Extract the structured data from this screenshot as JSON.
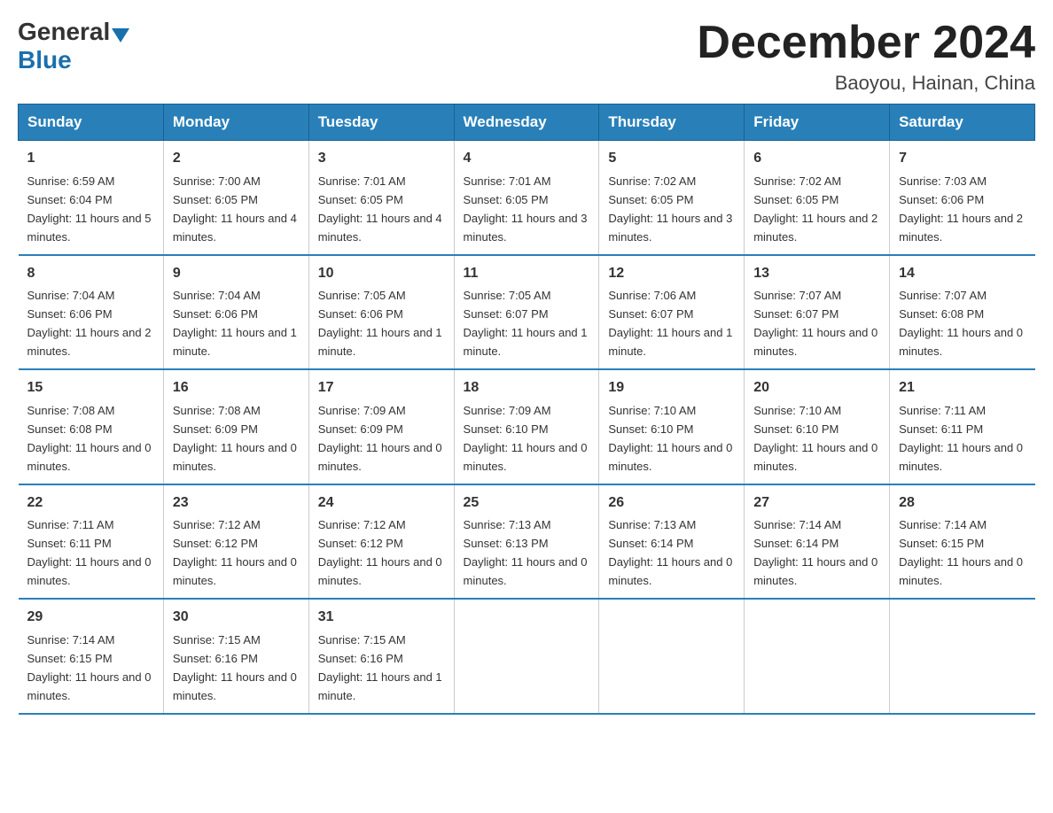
{
  "logo": {
    "general": "General",
    "blue": "Blue"
  },
  "header": {
    "month": "December 2024",
    "location": "Baoyou, Hainan, China"
  },
  "weekdays": [
    "Sunday",
    "Monday",
    "Tuesday",
    "Wednesday",
    "Thursday",
    "Friday",
    "Saturday"
  ],
  "weeks": [
    [
      {
        "day": "1",
        "sunrise": "6:59 AM",
        "sunset": "6:04 PM",
        "daylight": "11 hours and 5 minutes."
      },
      {
        "day": "2",
        "sunrise": "7:00 AM",
        "sunset": "6:05 PM",
        "daylight": "11 hours and 4 minutes."
      },
      {
        "day": "3",
        "sunrise": "7:01 AM",
        "sunset": "6:05 PM",
        "daylight": "11 hours and 4 minutes."
      },
      {
        "day": "4",
        "sunrise": "7:01 AM",
        "sunset": "6:05 PM",
        "daylight": "11 hours and 3 minutes."
      },
      {
        "day": "5",
        "sunrise": "7:02 AM",
        "sunset": "6:05 PM",
        "daylight": "11 hours and 3 minutes."
      },
      {
        "day": "6",
        "sunrise": "7:02 AM",
        "sunset": "6:05 PM",
        "daylight": "11 hours and 2 minutes."
      },
      {
        "day": "7",
        "sunrise": "7:03 AM",
        "sunset": "6:06 PM",
        "daylight": "11 hours and 2 minutes."
      }
    ],
    [
      {
        "day": "8",
        "sunrise": "7:04 AM",
        "sunset": "6:06 PM",
        "daylight": "11 hours and 2 minutes."
      },
      {
        "day": "9",
        "sunrise": "7:04 AM",
        "sunset": "6:06 PM",
        "daylight": "11 hours and 1 minute."
      },
      {
        "day": "10",
        "sunrise": "7:05 AM",
        "sunset": "6:06 PM",
        "daylight": "11 hours and 1 minute."
      },
      {
        "day": "11",
        "sunrise": "7:05 AM",
        "sunset": "6:07 PM",
        "daylight": "11 hours and 1 minute."
      },
      {
        "day": "12",
        "sunrise": "7:06 AM",
        "sunset": "6:07 PM",
        "daylight": "11 hours and 1 minute."
      },
      {
        "day": "13",
        "sunrise": "7:07 AM",
        "sunset": "6:07 PM",
        "daylight": "11 hours and 0 minutes."
      },
      {
        "day": "14",
        "sunrise": "7:07 AM",
        "sunset": "6:08 PM",
        "daylight": "11 hours and 0 minutes."
      }
    ],
    [
      {
        "day": "15",
        "sunrise": "7:08 AM",
        "sunset": "6:08 PM",
        "daylight": "11 hours and 0 minutes."
      },
      {
        "day": "16",
        "sunrise": "7:08 AM",
        "sunset": "6:09 PM",
        "daylight": "11 hours and 0 minutes."
      },
      {
        "day": "17",
        "sunrise": "7:09 AM",
        "sunset": "6:09 PM",
        "daylight": "11 hours and 0 minutes."
      },
      {
        "day": "18",
        "sunrise": "7:09 AM",
        "sunset": "6:10 PM",
        "daylight": "11 hours and 0 minutes."
      },
      {
        "day": "19",
        "sunrise": "7:10 AM",
        "sunset": "6:10 PM",
        "daylight": "11 hours and 0 minutes."
      },
      {
        "day": "20",
        "sunrise": "7:10 AM",
        "sunset": "6:10 PM",
        "daylight": "11 hours and 0 minutes."
      },
      {
        "day": "21",
        "sunrise": "7:11 AM",
        "sunset": "6:11 PM",
        "daylight": "11 hours and 0 minutes."
      }
    ],
    [
      {
        "day": "22",
        "sunrise": "7:11 AM",
        "sunset": "6:11 PM",
        "daylight": "11 hours and 0 minutes."
      },
      {
        "day": "23",
        "sunrise": "7:12 AM",
        "sunset": "6:12 PM",
        "daylight": "11 hours and 0 minutes."
      },
      {
        "day": "24",
        "sunrise": "7:12 AM",
        "sunset": "6:12 PM",
        "daylight": "11 hours and 0 minutes."
      },
      {
        "day": "25",
        "sunrise": "7:13 AM",
        "sunset": "6:13 PM",
        "daylight": "11 hours and 0 minutes."
      },
      {
        "day": "26",
        "sunrise": "7:13 AM",
        "sunset": "6:14 PM",
        "daylight": "11 hours and 0 minutes."
      },
      {
        "day": "27",
        "sunrise": "7:14 AM",
        "sunset": "6:14 PM",
        "daylight": "11 hours and 0 minutes."
      },
      {
        "day": "28",
        "sunrise": "7:14 AM",
        "sunset": "6:15 PM",
        "daylight": "11 hours and 0 minutes."
      }
    ],
    [
      {
        "day": "29",
        "sunrise": "7:14 AM",
        "sunset": "6:15 PM",
        "daylight": "11 hours and 0 minutes."
      },
      {
        "day": "30",
        "sunrise": "7:15 AM",
        "sunset": "6:16 PM",
        "daylight": "11 hours and 0 minutes."
      },
      {
        "day": "31",
        "sunrise": "7:15 AM",
        "sunset": "6:16 PM",
        "daylight": "11 hours and 1 minute."
      },
      null,
      null,
      null,
      null
    ]
  ]
}
